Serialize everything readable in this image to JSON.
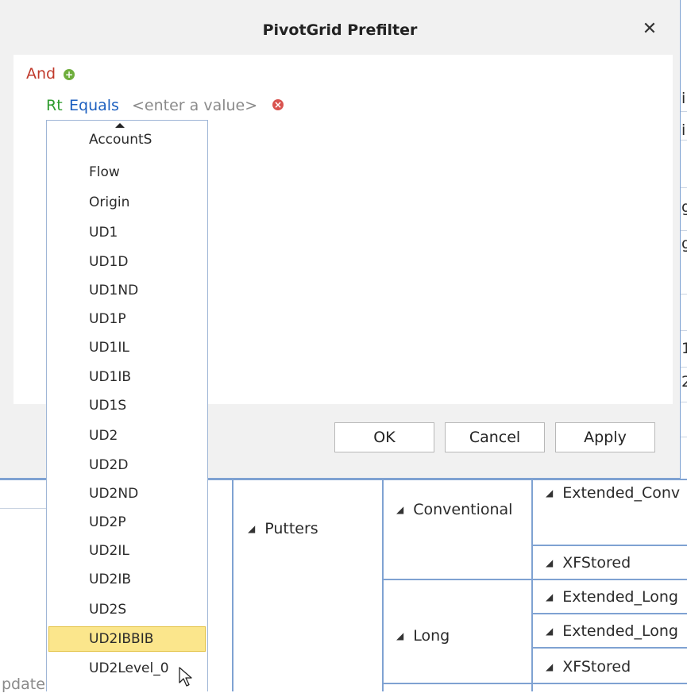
{
  "dialog": {
    "title": "PivotGrid Prefilter",
    "close_label": "✕",
    "ok_label": "OK",
    "cancel_label": "Cancel",
    "apply_label": "Apply"
  },
  "filter": {
    "group_operator": "And",
    "condition": {
      "field": "Rt",
      "operator": "Equals",
      "value_placeholder": "<enter a value>"
    }
  },
  "dropdown": {
    "items": [
      "AccountS",
      "Flow",
      "Origin",
      "UD1",
      "UD1D",
      "UD1ND",
      "UD1P",
      "UD1IL",
      "UD1IB",
      "UD1S",
      "UD2",
      "UD2D",
      "UD2ND",
      "UD2P",
      "UD2IL",
      "UD2IB",
      "UD2S",
      "UD2IBBIB",
      "UD2Level_0"
    ],
    "selected": "UD2IBBIB"
  },
  "grid": {
    "putters": "Putters",
    "conventional": "Conventional",
    "long": "Long",
    "extended_conv": "Extended_Conv",
    "xfstored_1": "XFStored",
    "extended_long_1": "Extended_Long",
    "extended_long_2": "Extended_Long",
    "xfstored_2": "XFStored",
    "bottom_left_text": "pdate",
    "right_edge_chars": [
      "i",
      "i",
      "g",
      "g",
      "1",
      "2"
    ]
  },
  "colors": {
    "accent": "#7fa2d2",
    "selection": "#fbe68c",
    "and_operator": "#c0392b",
    "field_name": "#2e9c2e",
    "operator_name": "#1c5fbf"
  }
}
